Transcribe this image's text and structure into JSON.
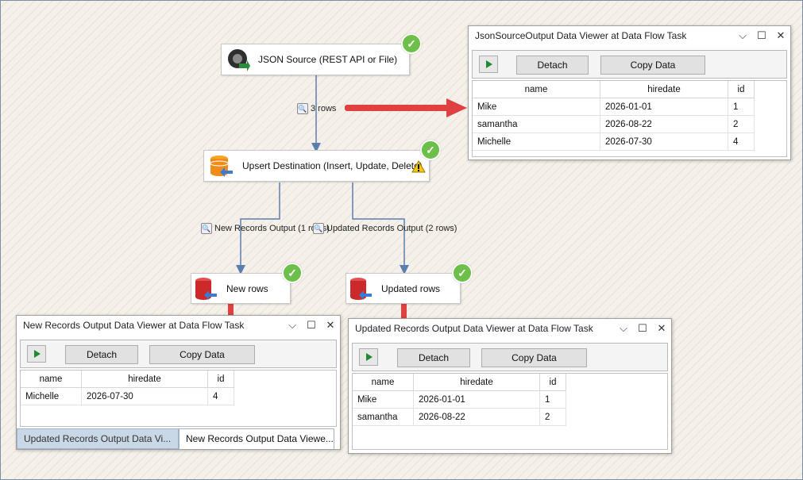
{
  "nodes": {
    "json_source": {
      "label": "JSON Source (REST API or File)"
    },
    "upsert": {
      "label": "Upsert Destination (Insert, Update, Delete)"
    },
    "new_rows": {
      "label": "New rows"
    },
    "updated_rows": {
      "label": "Updated rows"
    }
  },
  "paths": {
    "source_to_upsert": "3 rows",
    "new_records": "New Records Output (1 rows)",
    "updated_records": "Updated Records Output (2 rows)"
  },
  "viewers": {
    "json_source": {
      "title": "JsonSourceOutput Data Viewer at Data Flow Task",
      "detach": "Detach",
      "copy": "Copy Data",
      "columns": [
        "name",
        "hiredate",
        "id"
      ],
      "rows": [
        [
          "Mike",
          "2026-01-01",
          "1"
        ],
        [
          "samantha",
          "2026-08-22",
          "2"
        ],
        [
          "Michelle",
          "2026-07-30",
          "4"
        ]
      ]
    },
    "new_records": {
      "title": "New Records Output Data Viewer at Data Flow Task",
      "detach": "Detach",
      "copy": "Copy Data",
      "columns": [
        "name",
        "hiredate",
        "id"
      ],
      "rows": [
        [
          "Michelle",
          "2026-07-30",
          "4"
        ]
      ],
      "tabs": [
        "Updated Records Output Data Vi...",
        "New Records Output Data Viewe..."
      ]
    },
    "updated_records": {
      "title": "Updated Records Output Data Viewer at Data Flow Task",
      "detach": "Detach",
      "copy": "Copy Data",
      "columns": [
        "name",
        "hiredate",
        "id"
      ],
      "rows": [
        [
          "Mike",
          "2026-01-01",
          "1"
        ],
        [
          "samantha",
          "2026-08-22",
          "2"
        ]
      ]
    }
  },
  "window_buttons": {
    "dropdown": "⌵",
    "maximize": "☐",
    "close": "✕"
  },
  "colors": {
    "arrow": "#e0403f",
    "wire": "#5a7fae",
    "success": "#6cc04a",
    "warning": "#f3c911"
  }
}
